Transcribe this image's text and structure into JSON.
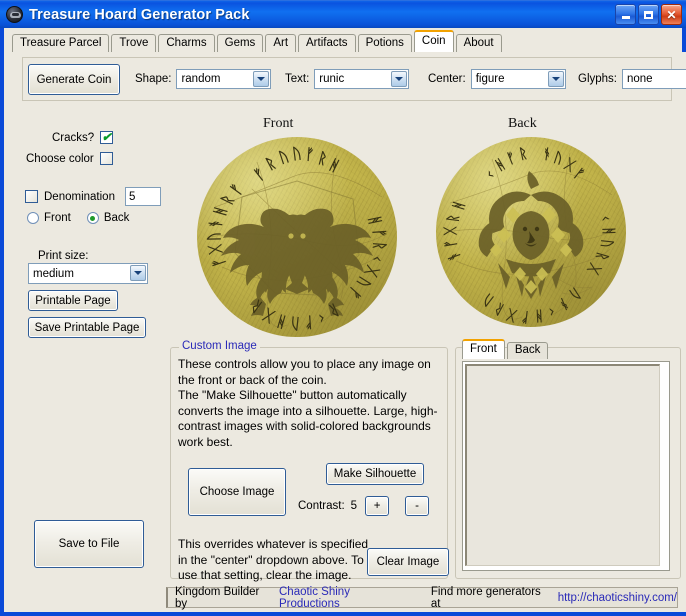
{
  "window": {
    "title": "Treasure Hoard Generator Pack",
    "icon": "coin-skull-icon",
    "buttons": {
      "minimize": "minimize-icon",
      "maximize": "maximize-icon",
      "close": "close-icon"
    }
  },
  "tabs": [
    {
      "label": "Treasure Parcel",
      "active": false
    },
    {
      "label": "Trove",
      "active": false
    },
    {
      "label": "Charms",
      "active": false
    },
    {
      "label": "Gems",
      "active": false
    },
    {
      "label": "Art",
      "active": false
    },
    {
      "label": "Artifacts",
      "active": false
    },
    {
      "label": "Potions",
      "active": false
    },
    {
      "label": "Coin",
      "active": true
    },
    {
      "label": "About",
      "active": false
    }
  ],
  "toolbar": {
    "generate_label": "Generate Coin",
    "fields": [
      {
        "label": "Shape:",
        "value": "random"
      },
      {
        "label": "Text:",
        "value": "runic"
      },
      {
        "label": "Center:",
        "value": "figure"
      },
      {
        "label": "Glyphs:",
        "value": "none"
      }
    ]
  },
  "left_panel": {
    "cracks_label": "Cracks?",
    "cracks_checked": true,
    "choose_color_label": "Choose color",
    "choose_color_checked": false,
    "denomination_label": "Denomination",
    "denomination_checked": false,
    "denomination_value": "5",
    "side_front_label": "Front",
    "side_back_label": "Back",
    "side_selected": "Back",
    "print_size_label": "Print size:",
    "print_size_value": "medium",
    "printable_page_label": "Printable Page",
    "save_printable_page_label": "Save Printable Page",
    "save_to_file_label": "Save to File"
  },
  "coins": {
    "front_label": "Front",
    "back_label": "Back",
    "front_center": "twin-dragon-figure",
    "back_center": "jester-figure",
    "base_color": "#c2b44a",
    "figure_color": "#6b6028"
  },
  "custom_image": {
    "title": "Custom Image",
    "paragraph1": "These controls allow you to place any image on the front or back of the coin.",
    "paragraph2": "The \"Make Silhouette\" button automatically converts the image into a silhouette. Large, high-contrast  images with solid-colored backgrounds work best.",
    "choose_image_label": "Choose Image",
    "make_silhouette_label": "Make Silhouette",
    "contrast_label": "Contrast:",
    "contrast_value": "5",
    "contrast_plus": "+",
    "contrast_minus": "-",
    "paragraph3": "This overrides whatever is specified in the \"center\" dropdown above. To use that setting, clear the image.",
    "clear_image_label": "Clear Image"
  },
  "preview_panel": {
    "tabs": [
      {
        "label": "Front",
        "active": true
      },
      {
        "label": "Back",
        "active": false
      }
    ]
  },
  "statusbar": {
    "text1": "Kingdom Builder by",
    "link1": "Chaotic Shiny Productions",
    "text2": "Find more generators at",
    "link2": "http://chaoticshiny.com/"
  }
}
